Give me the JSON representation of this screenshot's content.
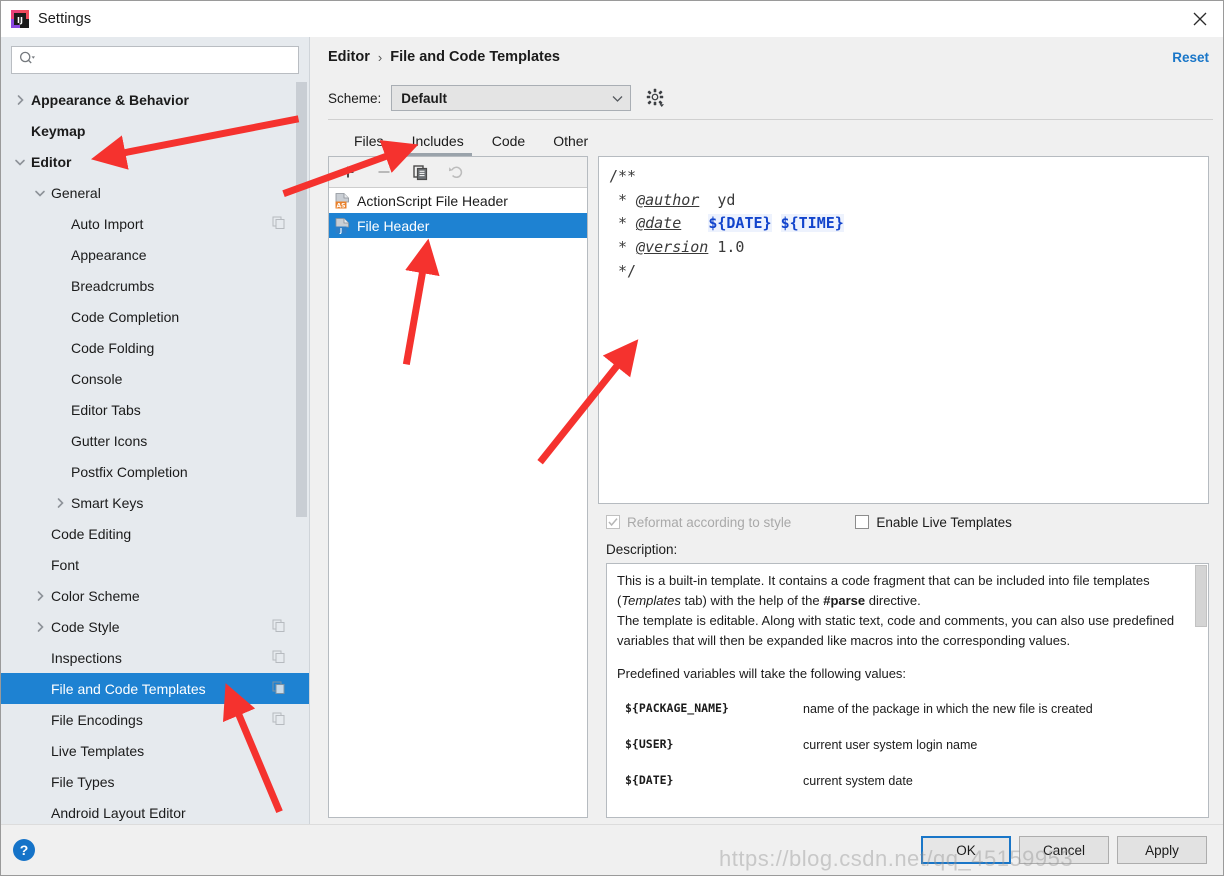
{
  "window": {
    "title": "Settings",
    "app_icon": "intellij-idea-logo",
    "close_icon": "close-icon"
  },
  "search": {
    "placeholder": "",
    "value": "",
    "icon": "search-icon"
  },
  "sidebar": {
    "items": [
      {
        "label": "Appearance & Behavior",
        "indent": 0,
        "twisty": "right",
        "bold": true,
        "selected": false,
        "badge": false
      },
      {
        "label": "Keymap",
        "indent": 0,
        "twisty": "none",
        "bold": true,
        "selected": false,
        "badge": false
      },
      {
        "label": "Editor",
        "indent": 0,
        "twisty": "down",
        "bold": true,
        "selected": false,
        "badge": false
      },
      {
        "label": "General",
        "indent": 1,
        "twisty": "down",
        "bold": false,
        "selected": false,
        "badge": false
      },
      {
        "label": "Auto Import",
        "indent": 2,
        "twisty": "none",
        "bold": false,
        "selected": false,
        "badge": true
      },
      {
        "label": "Appearance",
        "indent": 2,
        "twisty": "none",
        "bold": false,
        "selected": false,
        "badge": false
      },
      {
        "label": "Breadcrumbs",
        "indent": 2,
        "twisty": "none",
        "bold": false,
        "selected": false,
        "badge": false
      },
      {
        "label": "Code Completion",
        "indent": 2,
        "twisty": "none",
        "bold": false,
        "selected": false,
        "badge": false
      },
      {
        "label": "Code Folding",
        "indent": 2,
        "twisty": "none",
        "bold": false,
        "selected": false,
        "badge": false
      },
      {
        "label": "Console",
        "indent": 2,
        "twisty": "none",
        "bold": false,
        "selected": false,
        "badge": false
      },
      {
        "label": "Editor Tabs",
        "indent": 2,
        "twisty": "none",
        "bold": false,
        "selected": false,
        "badge": false
      },
      {
        "label": "Gutter Icons",
        "indent": 2,
        "twisty": "none",
        "bold": false,
        "selected": false,
        "badge": false
      },
      {
        "label": "Postfix Completion",
        "indent": 2,
        "twisty": "none",
        "bold": false,
        "selected": false,
        "badge": false
      },
      {
        "label": "Smart Keys",
        "indent": 2,
        "twisty": "right",
        "bold": false,
        "selected": false,
        "badge": false
      },
      {
        "label": "Code Editing",
        "indent": 1,
        "twisty": "none",
        "bold": false,
        "selected": false,
        "badge": false
      },
      {
        "label": "Font",
        "indent": 1,
        "twisty": "none",
        "bold": false,
        "selected": false,
        "badge": false
      },
      {
        "label": "Color Scheme",
        "indent": 1,
        "twisty": "right",
        "bold": false,
        "selected": false,
        "badge": false
      },
      {
        "label": "Code Style",
        "indent": 1,
        "twisty": "right",
        "bold": false,
        "selected": false,
        "badge": true
      },
      {
        "label": "Inspections",
        "indent": 1,
        "twisty": "none",
        "bold": false,
        "selected": false,
        "badge": true
      },
      {
        "label": "File and Code Templates",
        "indent": 1,
        "twisty": "none",
        "bold": false,
        "selected": true,
        "badge": true
      },
      {
        "label": "File Encodings",
        "indent": 1,
        "twisty": "none",
        "bold": false,
        "selected": false,
        "badge": true
      },
      {
        "label": "Live Templates",
        "indent": 1,
        "twisty": "none",
        "bold": false,
        "selected": false,
        "badge": false
      },
      {
        "label": "File Types",
        "indent": 1,
        "twisty": "none",
        "bold": false,
        "selected": false,
        "badge": false
      },
      {
        "label": "Android Layout Editor",
        "indent": 1,
        "twisty": "none",
        "bold": false,
        "selected": false,
        "badge": false
      }
    ]
  },
  "breadcrumb": {
    "parent": "Editor",
    "separator": "›",
    "current": "File and Code Templates",
    "reset_label": "Reset"
  },
  "scheme": {
    "label": "Scheme:",
    "value": "Default",
    "dropdown_icon": "chevron-down-icon",
    "gear_icon": "gear-icon"
  },
  "tabs": [
    {
      "label": "Files",
      "active": false
    },
    {
      "label": "Includes",
      "active": true
    },
    {
      "label": "Code",
      "active": false
    },
    {
      "label": "Other",
      "active": false
    }
  ],
  "list_toolbar": [
    {
      "name": "add-button",
      "icon": "plus-icon",
      "enabled": true
    },
    {
      "name": "remove-button",
      "icon": "minus-icon",
      "enabled": false
    },
    {
      "name": "copy-button",
      "icon": "copy-icon",
      "enabled": true
    },
    {
      "name": "reset-button",
      "icon": "undo-icon",
      "enabled": false
    }
  ],
  "template_list": [
    {
      "label": "ActionScript File Header",
      "icon": "actionscript-file-icon",
      "badge": "AS",
      "selected": false
    },
    {
      "label": "File Header",
      "icon": "java-file-icon",
      "badge": "J",
      "selected": true
    }
  ],
  "code": {
    "lines": [
      [
        {
          "t": "/**",
          "s": "plain"
        }
      ],
      [
        {
          "t": " * ",
          "s": "plain"
        },
        {
          "t": "@author",
          "s": "tag"
        },
        {
          "t": "  yd",
          "s": "plain"
        }
      ],
      [
        {
          "t": " * ",
          "s": "plain"
        },
        {
          "t": "@date",
          "s": "tag"
        },
        {
          "t": "   ",
          "s": "plain"
        },
        {
          "t": "${DATE}",
          "s": "var"
        },
        {
          "t": " ",
          "s": "plain"
        },
        {
          "t": "${TIME}",
          "s": "var"
        }
      ],
      [
        {
          "t": " * ",
          "s": "plain"
        },
        {
          "t": "@version",
          "s": "tag"
        },
        {
          "t": " 1.0",
          "s": "plain"
        }
      ],
      [
        {
          "t": " */",
          "s": "plain"
        }
      ]
    ]
  },
  "checkboxes": {
    "reformat": {
      "label_pre": "",
      "label": "Reformat according to style",
      "accel": "R",
      "checked": true,
      "enabled": false
    },
    "live": {
      "label": "Enable Live Templates",
      "accel": "L",
      "checked": false,
      "enabled": true
    }
  },
  "description": {
    "title": "Description:",
    "paragraph1_a": "This is a built-in template. It contains a code fragment that can be included into file templates (",
    "paragraph1_em": "Templates",
    "paragraph1_b": " tab) with the help of the ",
    "paragraph1_code": "#parse",
    "paragraph1_c": " directive.",
    "paragraph2": "The template is editable. Along with static text, code and comments, you can also use predefined variables that will then be expanded like macros into the corresponding values.",
    "paragraph3": "Predefined variables will take the following values:",
    "variables": [
      {
        "name": "${PACKAGE_NAME}",
        "desc": "name of the package in which the new file is created"
      },
      {
        "name": "${USER}",
        "desc": "current user system login name"
      },
      {
        "name": "${DATE}",
        "desc": "current system date"
      }
    ]
  },
  "footer": {
    "help_icon": "help-icon",
    "buttons": [
      {
        "label": "OK",
        "accel": "",
        "default": true
      },
      {
        "label": "Cancel",
        "accel": "",
        "default": false
      },
      {
        "label": "Apply",
        "accel": "A",
        "default": false
      }
    ]
  },
  "watermark": "https://blog.csdn.net/qq_45159953",
  "colors": {
    "selection_blue": "#1e82d2",
    "link_blue": "#1976c8",
    "sidebar_bg": "#e6eaee",
    "panel_bg": "#f0f0f0",
    "arrow_red": "#f5322e",
    "code_var_blue": "#1244cc"
  }
}
